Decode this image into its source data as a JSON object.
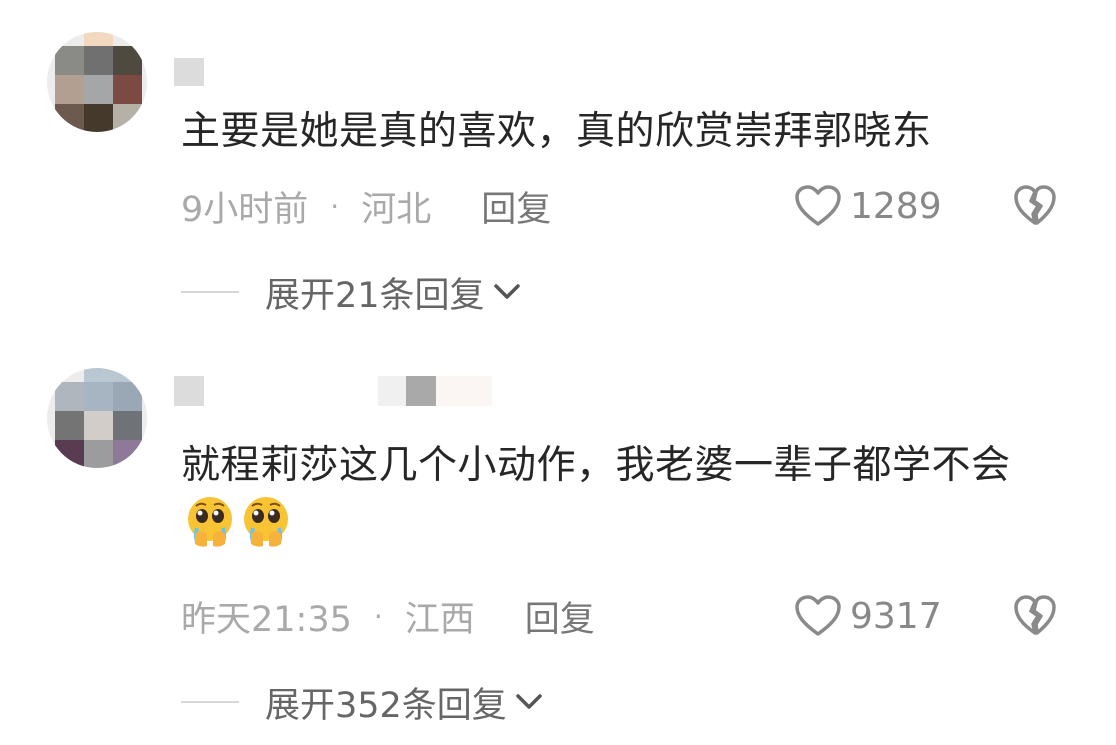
{
  "comments": [
    {
      "text": "主要是她是真的喜欢，真的欣赏崇拜郭晓东",
      "time": "9小时前",
      "separator": "·",
      "location": "河北",
      "reply_label": "回复",
      "like_count": "1289",
      "expand_label": "展开21条回复"
    },
    {
      "text": "就程莉莎这几个小动作，我老婆一辈子都学不会",
      "time": "昨天21:35",
      "separator": "·",
      "location": "江西",
      "reply_label": "回复",
      "like_count": "9317",
      "expand_label": "展开352条回复"
    }
  ],
  "colors": {
    "text": "#262626",
    "meta": "#a9a9a9",
    "icon": "#8a8a8a",
    "divider": "#d8d8d8"
  },
  "icons": {
    "like": "heart-outline-icon",
    "dislike": "broken-heart-icon",
    "expand": "chevron-down-icon",
    "emoji": "pleading-face-emoji"
  }
}
